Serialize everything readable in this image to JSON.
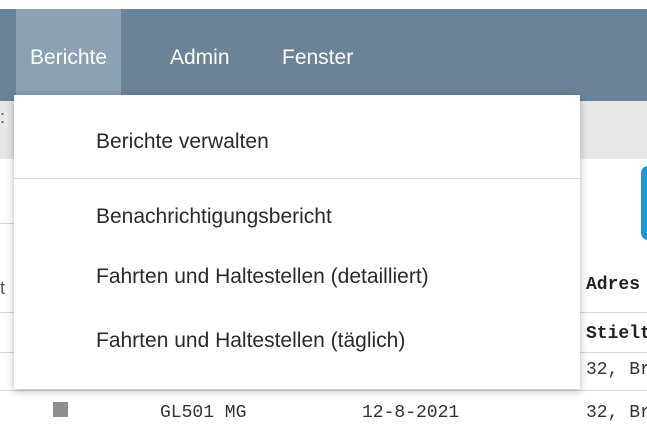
{
  "menubar": {
    "items": [
      {
        "label": "Berichte",
        "active": true
      },
      {
        "label": "Admin",
        "active": false
      },
      {
        "label": "Fenster",
        "active": false
      }
    ],
    "bg_color": "#6b8399",
    "active_color": "#8ca1b4"
  },
  "dropdown": {
    "items": [
      {
        "label": "Berichte verwalten"
      },
      {
        "label": "Benachrichtigungsbericht"
      },
      {
        "label": "Fahrten und Haltestellen (detailliert)"
      },
      {
        "label": "Fahrten und Haltestellen (täglich)"
      }
    ]
  },
  "background": {
    "header_adres": "Adres",
    "cell_stielt": "Stielt",
    "cell_addr1": "32, Br",
    "cell_addr2": "32, Br",
    "row": {
      "plate": "GL501 MG",
      "date": "12-8-2021"
    },
    "accent_color": "#1e9bd6"
  }
}
